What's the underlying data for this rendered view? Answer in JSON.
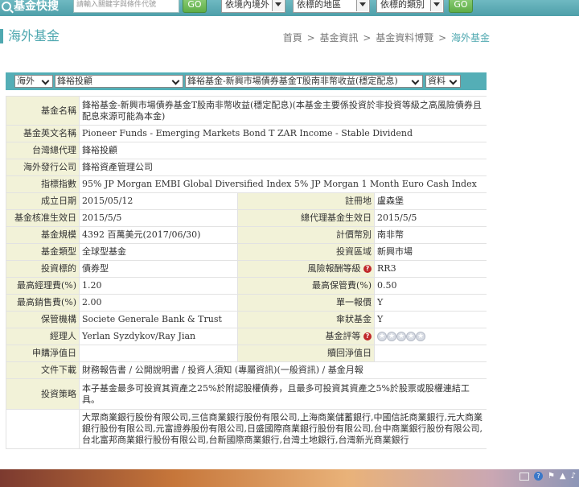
{
  "topbar": {
    "brand": "基金快搜",
    "keyword_placeholder": "請輸入關鍵字與條件代號",
    "go_label": "GO",
    "region_select": "依境內境外",
    "area_select": "依標的地區",
    "type_select": "依標的類別",
    "go2_label": "GO"
  },
  "heading": {
    "title": "海外基金",
    "breadcrumb": [
      "首頁",
      "基金資訊",
      "基金資料博覽",
      "海外基金"
    ],
    "separator": ">"
  },
  "filters": {
    "market": "海外",
    "company": "鋒裕投顧",
    "fund": "鋒裕基金-新興市場債券基金T股南非幣收益(穩定配息)",
    "info": "資料"
  },
  "info": {
    "fund_name_label": "基金名稱",
    "fund_name": "鋒裕基金-新興市場債券基金T股南非幣收益(穩定配息)(本基金主要係投資於非投資等級之高風險債券且配息來源可能為本金)",
    "english_name_label": "基金英文名稱",
    "english_name": "Pioneer Funds - Emerging Markets Bond T ZAR Income - Stable Dividend",
    "agent_label": "台灣總代理",
    "agent": "鋒裕投顧",
    "issuer_label": "海外發行公司",
    "issuer": "鋒裕資產管理公司",
    "index_label": "指標指數",
    "index": "95% JP Morgan EMBI Global Diversified Index 5% JP Morgan 1 Month Euro Cash Index",
    "inception_label": "成立日期",
    "inception": "2015/05/12",
    "domicile_label": "註冊地",
    "domicile": "盧森堡",
    "approved_label": "基金核准生效日",
    "approved": "2015/5/5",
    "agent_effective_label": "總代理基金生效日",
    "agent_effective": "2015/5/5",
    "size_label": "基金規模",
    "size": "4392 百萬美元(2017/06/30)",
    "currency_label": "計價幣別",
    "currency": "南非幣",
    "fund_type_label": "基金類型",
    "fund_type": "全球型基金",
    "invest_region_label": "投資區域",
    "invest_region": "新興市場",
    "target_label": "投資標的",
    "target": "債券型",
    "risk_label": "風險報酬等級",
    "risk": "RR3",
    "max_mgmt_fee_label": "最高經理費(%)",
    "max_mgmt_fee": "1.20",
    "max_custody_fee_label": "最高保管費(%)",
    "max_custody_fee": "0.50",
    "max_sales_fee_label": "最高銷售費(%)",
    "max_sales_fee": "2.00",
    "single_price_label": "單一報價",
    "single_price": "Y",
    "custodian_label": "保管機構",
    "custodian": "Societe Generale Bank & Trust",
    "umbrella_label": "傘狀基金",
    "umbrella": "Y",
    "manager_label": "經理人",
    "manager": "Yerlan Syzdykov/Ray Jian",
    "rating_label": "基金評等",
    "subscription_nav_label": "申購淨值日",
    "subscription_nav": "",
    "redemption_nav_label": "贖回淨值日",
    "redemption_nav": "",
    "downloads_label": "文件下載",
    "downloads": "財務報告書 / 公開說明書 / 投資人須知 (專屬資訊)(一般資訊) / 基金月報",
    "strategy_label": "投資策略",
    "strategy": "本子基金最多可投資其資產之25%於附認股權債券，且最多可投資其資產之5%於股票或股權連結工具。",
    "banks": "大眾商業銀行股份有限公司,三信商業銀行股份有限公司,上海商業儲蓄銀行,中國信託商業銀行,元大商業銀行股份有限公司,元富證券股份有限公司,日盛國際商業銀行股份有限公司,台中商業銀行股份有限公司,台北富邦商業銀行股份有限公司,台新國際商業銀行,台灣土地銀行,台灣新光商業銀行"
  },
  "taskbar": {
    "help": "?"
  }
}
